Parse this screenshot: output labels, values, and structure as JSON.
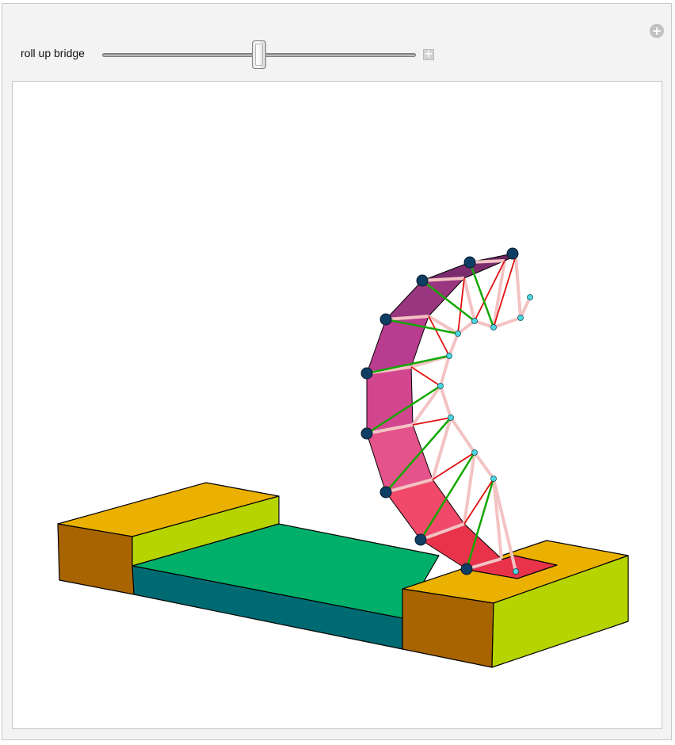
{
  "controls": {
    "slider_label": "roll up bridge",
    "slider_value": 0.5,
    "options_icon": "plus-circle-icon",
    "expand_icon": "plus-square-icon"
  },
  "colors": {
    "panel_bg": "#f3f3f3",
    "box_top": "#ebb100",
    "box_front_orange": "#a86400",
    "box_side_lime": "#b6d400",
    "road_top": "#00af6a",
    "road_side": "#006a72",
    "arch_ribbon": "#d2458f",
    "truss_pink": "#f3c3c3",
    "brace_green": "#12a800",
    "brace_red": "#e01010",
    "joint_dark": "#0e3e64",
    "joint_cyan": "#4cd7e0"
  }
}
